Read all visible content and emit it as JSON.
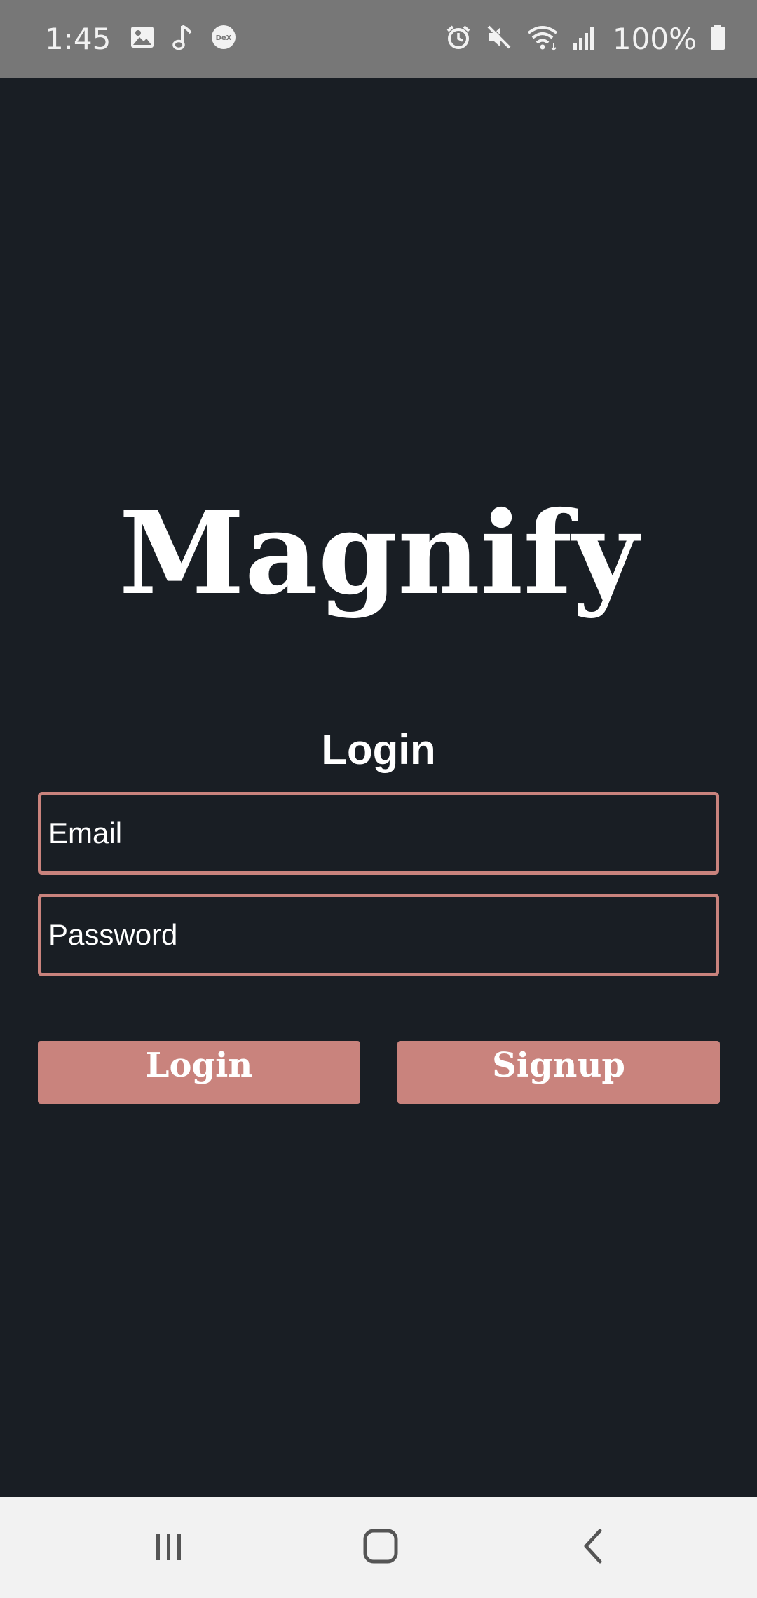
{
  "status_bar": {
    "time": "1:45",
    "battery_text": "100%",
    "left_icons": [
      "gallery-icon",
      "music-note-icon",
      "dex-icon"
    ],
    "right_icons": [
      "alarm-icon",
      "mute-icon",
      "wifi-icon",
      "signal-icon",
      "battery-icon"
    ]
  },
  "app": {
    "title": "Magnify"
  },
  "login_form": {
    "heading": "Login",
    "email_placeholder": "Email",
    "password_placeholder": "Password",
    "login_button": "Login",
    "signup_button": "Signup"
  },
  "nav_bar": {
    "icons": [
      "recents-icon",
      "home-icon",
      "back-icon"
    ]
  },
  "colors": {
    "background": "#191e24",
    "accent": "#c9837d",
    "status_bar": "#777777",
    "nav_bar": "#f2f2f2"
  }
}
